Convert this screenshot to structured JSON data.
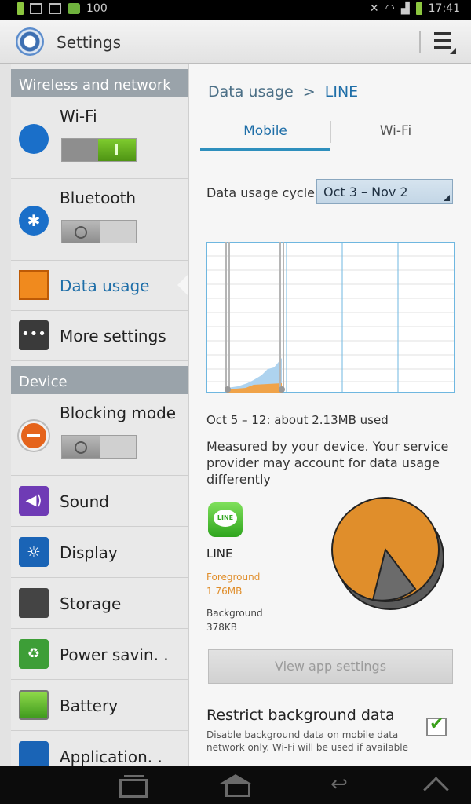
{
  "status_bar": {
    "battery_level": "100",
    "time": "17:41",
    "left_icons": [
      "battery-icon",
      "usb-icon",
      "gallery-icon",
      "line-notification-icon"
    ],
    "right_icons": [
      "mute-icon",
      "wifi-icon",
      "signal-icon",
      "battery-icon"
    ]
  },
  "action_bar": {
    "title": "Settings",
    "menu_icon": "menu-icon"
  },
  "sidebar": {
    "section_wireless": "Wireless and network",
    "section_device": "Device",
    "items": [
      {
        "label": "Wi-Fi",
        "icon": "wifi-icon",
        "toggle": "on"
      },
      {
        "label": "Bluetooth",
        "icon": "bluetooth-icon",
        "toggle": "off"
      },
      {
        "label": "Data usage",
        "icon": "data-usage-icon",
        "active": true
      },
      {
        "label": "More settings",
        "icon": "more-icon"
      },
      {
        "label": "Blocking mode",
        "icon": "blocking-icon",
        "toggle": "off"
      },
      {
        "label": "Sound",
        "icon": "sound-icon"
      },
      {
        "label": "Display",
        "icon": "display-icon"
      },
      {
        "label": "Storage",
        "icon": "storage-icon"
      },
      {
        "label": "Power savin. .",
        "icon": "power-saving-icon"
      },
      {
        "label": "Battery",
        "icon": "battery-icon"
      },
      {
        "label": "Application. .",
        "icon": "application-icon"
      }
    ]
  },
  "detail": {
    "breadcrumb_parent": "Data usage",
    "breadcrumb_sep": ">",
    "breadcrumb_current": "LINE",
    "tabs": [
      {
        "label": "Mobile",
        "selected": true
      },
      {
        "label": "Wi-Fi",
        "selected": false
      }
    ],
    "cycle_label": "Data usage cycle",
    "cycle_value": "Oct 3 – Nov 2",
    "usage_text": "Oct 5 – 12: about 2.13MB used",
    "measured_text": "Measured by your device. Your service provider may account for data usage differently",
    "app_name": "LINE",
    "foreground_label": "Foreground",
    "foreground_value": "1.76MB",
    "background_label": "Background",
    "background_value": "378KB",
    "app_settings_button": "View app settings",
    "restrict_title": "Restrict background data",
    "restrict_desc": "Disable background data on mobile data network only. Wi-Fi will be used if available",
    "restrict_checked": true,
    "colors": {
      "accent": "#1e6ea8",
      "foreground": "#e08e2b",
      "background": "#666666",
      "chart_line": "#7ec3ea"
    }
  },
  "nav_bar": {
    "icons": [
      "recent-apps-icon",
      "home-icon",
      "back-icon",
      "up-icon"
    ]
  }
}
